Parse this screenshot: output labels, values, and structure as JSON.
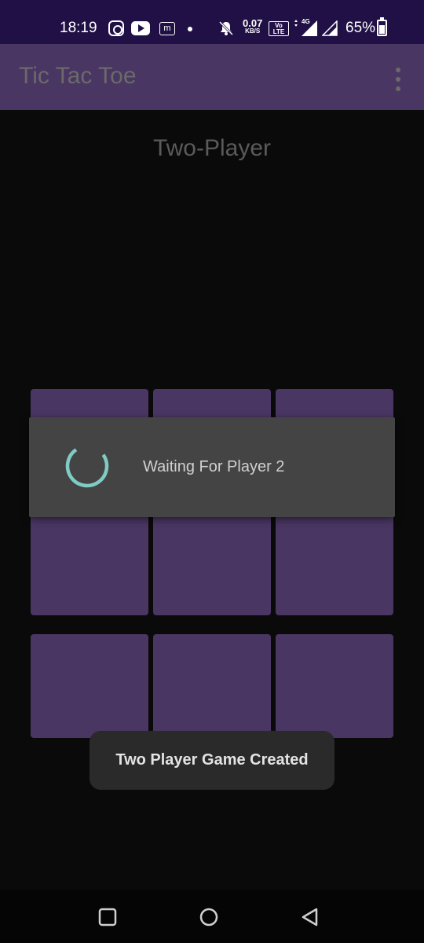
{
  "status_bar": {
    "time": "18:19",
    "net_speed_value": "0.07",
    "net_speed_unit": "KB/S",
    "volte_label": "Vo LTE 1",
    "network_label": "4G",
    "battery_percent": "65%",
    "icons": [
      "instagram-icon",
      "youtube-icon",
      "m-app-icon",
      "notification-dot-icon",
      "bell-muted-icon",
      "volte-icon",
      "signal-4g-icon",
      "signal-icon",
      "battery-icon"
    ]
  },
  "app_bar": {
    "title": "Tic Tac Toe",
    "menu_icon": "overflow-menu-icon"
  },
  "game": {
    "mode": "Two-Player",
    "board": [
      "",
      "",
      "",
      "",
      "",
      "",
      "",
      "",
      ""
    ]
  },
  "progress_dialog": {
    "message": "Waiting For Player 2",
    "spinner_icon": "progress-spinner-icon"
  },
  "toast": {
    "message": "Two Player Game Created"
  },
  "nav_bar": {
    "icons": [
      "recents-square-icon",
      "home-circle-icon",
      "back-triangle-icon"
    ]
  },
  "colors": {
    "status_bar": "#201046",
    "app_bar": "#4a3663",
    "cell": "#4a3663",
    "background": "#0a0a0a",
    "dialog": "#444444",
    "spinner": "#80cbc4",
    "toast": "#2a2a2a"
  }
}
